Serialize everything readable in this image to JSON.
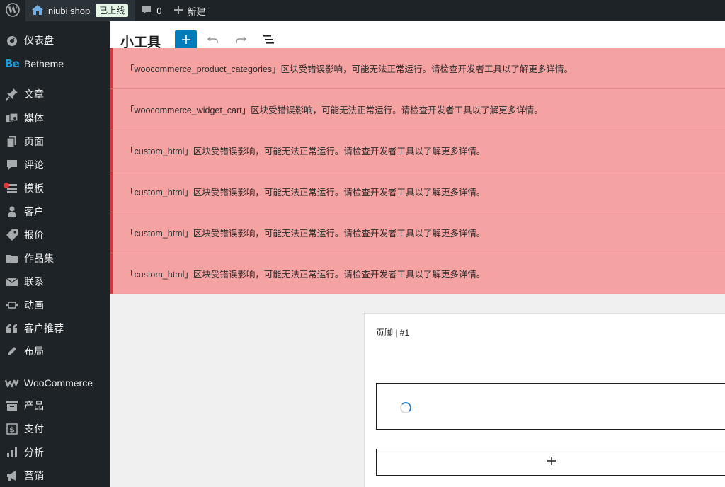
{
  "adminbar": {
    "site_name": "niubi shop",
    "status_badge": "已上线",
    "comments_count": "0",
    "new_label": "新建"
  },
  "sidebar": {
    "items": [
      {
        "label": "仪表盘",
        "icon": "dashboard-icon"
      },
      {
        "label": "Betheme",
        "icon": "betheme-icon"
      },
      {
        "label": "文章",
        "icon": "pin-icon"
      },
      {
        "label": "媒体",
        "icon": "media-icon"
      },
      {
        "label": "页面",
        "icon": "page-icon"
      },
      {
        "label": "评论",
        "icon": "comment-icon"
      },
      {
        "label": "模板",
        "icon": "template-icon"
      },
      {
        "label": "客户",
        "icon": "user-icon"
      },
      {
        "label": "报价",
        "icon": "tag-icon"
      },
      {
        "label": "作品集",
        "icon": "folder-icon"
      },
      {
        "label": "联系",
        "icon": "mail-icon"
      },
      {
        "label": "动画",
        "icon": "slides-icon"
      },
      {
        "label": "客户推荐",
        "icon": "quote-icon"
      },
      {
        "label": "布局",
        "icon": "edit-icon"
      },
      {
        "label": "WooCommerce",
        "icon": "woocommerce-icon"
      },
      {
        "label": "产品",
        "icon": "archive-icon"
      },
      {
        "label": "支付",
        "icon": "payment-icon"
      },
      {
        "label": "分析",
        "icon": "chart-bar-icon"
      },
      {
        "label": "营销",
        "icon": "megaphone-icon"
      }
    ]
  },
  "header": {
    "title": "小工具"
  },
  "notices": [
    "「woocommerce_product_categories」区块受错误影响，可能无法正常运行。请检查开发者工具以了解更多详情。",
    "「woocommerce_widget_cart」区块受错误影响，可能无法正常运行。请检查开发者工具以了解更多详情。",
    "「custom_html」区块受错误影响，可能无法正常运行。请检查开发者工具以了解更多详情。",
    "「custom_html」区块受错误影响，可能无法正常运行。请检查开发者工具以了解更多详情。",
    "「custom_html」区块受错误影响，可能无法正常运行。请检查开发者工具以了解更多详情。",
    "「custom_html」区块受错误影响，可能无法正常运行。请检查开发者工具以了解更多详情。"
  ],
  "widget_area": {
    "title": "页脚 | #1"
  },
  "colors": {
    "accent": "#007cba",
    "adminbar": "#1d2327",
    "notice_bg": "#f4a2a2",
    "notice_border": "#d63638"
  }
}
